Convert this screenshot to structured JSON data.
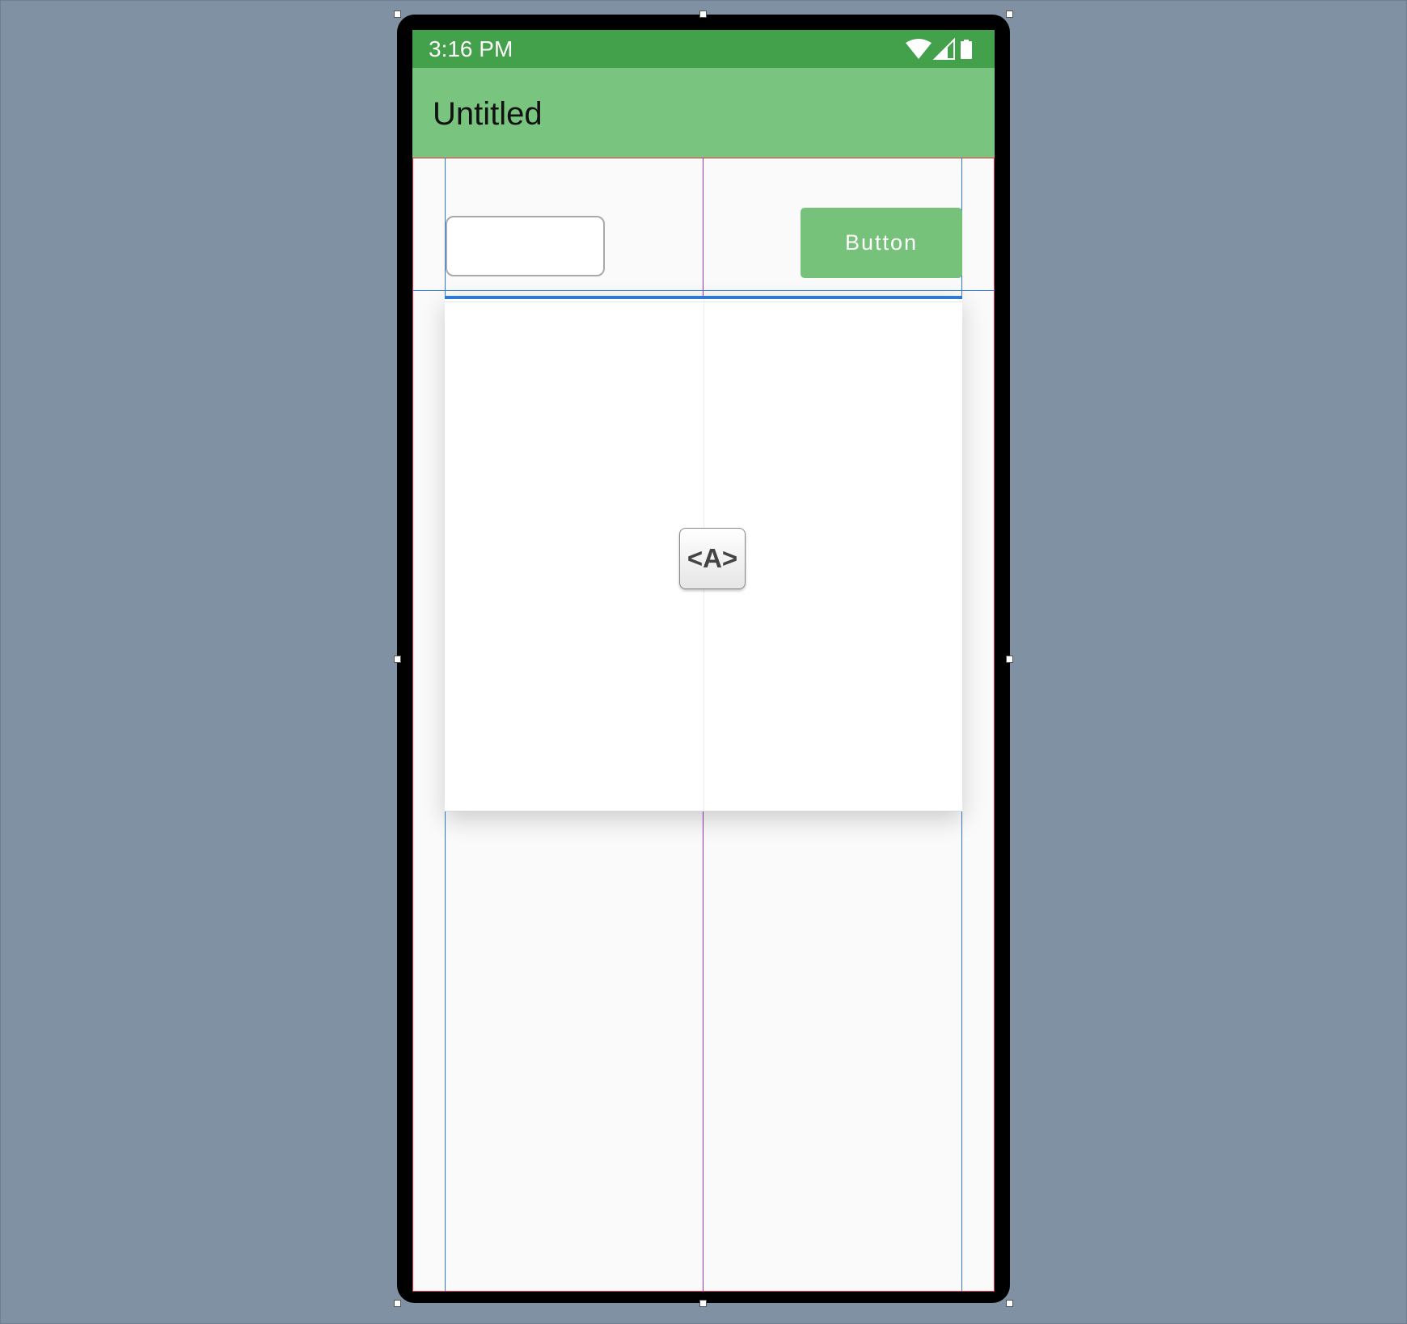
{
  "status_bar": {
    "time": "3:16 PM",
    "icons": [
      "wifi-icon",
      "cell-signal-icon",
      "battery-icon"
    ]
  },
  "app_bar": {
    "title": "Untitled"
  },
  "form": {
    "text_input_value": "",
    "button_label": "Button"
  },
  "panel": {
    "element_icon_label": "<A>"
  },
  "colors": {
    "status_bar": "#43a04b",
    "app_bar": "#79c57f",
    "button": "#76c27b",
    "guide_blue": "#2d7ad6",
    "guide_purple": "#9b2fc9",
    "guide_red": "#e3343c",
    "canvas": "#8091a3"
  }
}
